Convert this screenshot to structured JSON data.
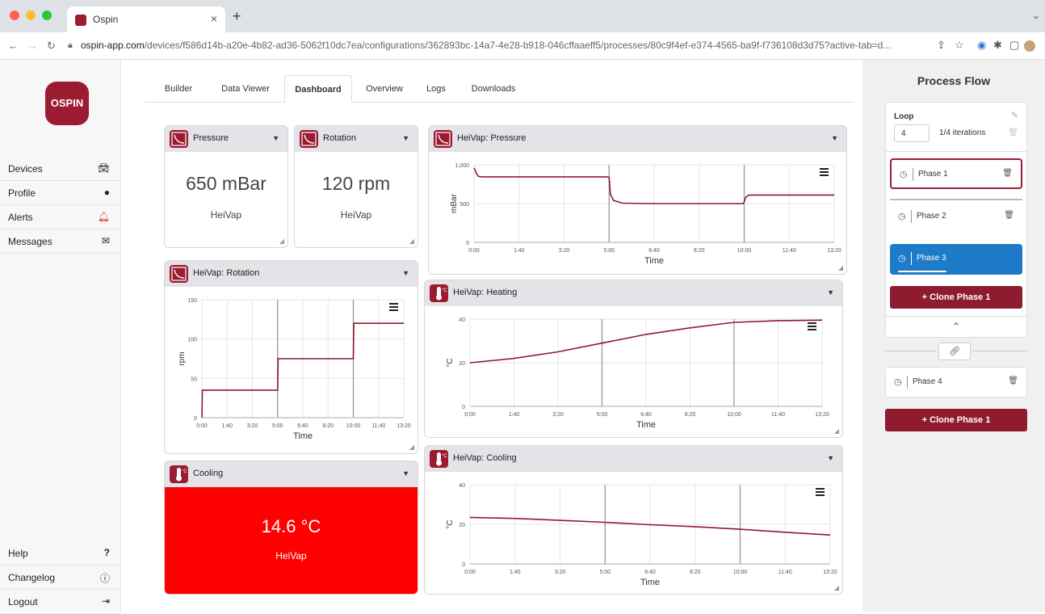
{
  "browser": {
    "tab_title": "Ospin",
    "tab_close": "×",
    "new_tab": "+",
    "url_domain": "ospin-app.com",
    "url_path": "/devices/f586d14b-a20e-4b82-ad36-5062f10dc7ea/configurations/362893bc-14a7-4e28-b918-046cffaaeff5/processes/80c9f4ef-e374-4565-ba9f-f736108d3d75?active-tab=d..."
  },
  "logo": "OSPIN",
  "sidebar": {
    "items": [
      {
        "label": "Devices",
        "icon": "car-icon"
      },
      {
        "label": "Profile",
        "icon": "user-icon"
      },
      {
        "label": "Alerts",
        "icon": "bell-icon"
      },
      {
        "label": "Messages",
        "icon": "envelope-icon"
      }
    ],
    "bottom": [
      {
        "label": "Help",
        "icon": "question-icon"
      },
      {
        "label": "Changelog",
        "icon": "info-icon"
      },
      {
        "label": "Logout",
        "icon": "logout-icon"
      }
    ]
  },
  "tabs": [
    "Builder",
    "Data Viewer",
    "Dashboard",
    "Overview",
    "Logs",
    "Downloads"
  ],
  "active_tab": "Dashboard",
  "widgets": {
    "pressure": {
      "title": "Pressure",
      "value": "650 mBar",
      "source": "HeiVap"
    },
    "rotation": {
      "title": "Rotation",
      "value": "120 rpm",
      "source": "HeiVap"
    },
    "cooling": {
      "title": "Cooling",
      "value": "14.6 °C",
      "source": "HeiVap",
      "color": "#ff0000"
    },
    "hv_pressure": {
      "title": "HeiVap: Pressure"
    },
    "hv_rotation": {
      "title": "HeiVap: Rotation"
    },
    "hv_heating": {
      "title": "HeiVap: Heating"
    },
    "hv_cooling": {
      "title": "HeiVap: Cooling"
    }
  },
  "chart_data": [
    {
      "type": "line",
      "id": "hv_pressure",
      "title": "HeiVap: Pressure",
      "xlabel": "Time",
      "ylabel": "mBar",
      "ylim": [
        0,
        1000
      ],
      "yticks": [
        0,
        500,
        1000
      ],
      "ytick_labels": [
        "0",
        "500",
        "1,000"
      ],
      "xticks": [
        "0:00",
        "1:40",
        "3:20",
        "5:00",
        "6:40",
        "8:20",
        "10:00",
        "11:40",
        "13:20"
      ],
      "xlim_seconds": [
        0,
        800
      ],
      "markers_seconds": [
        300,
        600
      ],
      "series": [
        {
          "x": [
            0,
            5,
            10,
            20,
            100,
            200,
            295,
            300,
            303,
            310,
            330,
            400,
            500,
            598,
            600,
            603,
            610,
            700,
            800
          ],
          "y": [
            960,
            890,
            850,
            845,
            845,
            845,
            845,
            840,
            620,
            540,
            505,
            500,
            500,
            500,
            520,
            580,
            610,
            610,
            610
          ]
        }
      ]
    },
    {
      "type": "line",
      "id": "hv_rotation",
      "title": "HeiVap: Rotation",
      "xlabel": "Time",
      "ylabel": "rpm",
      "ylim": [
        0,
        150
      ],
      "yticks": [
        0,
        50,
        100,
        150
      ],
      "ytick_labels": [
        "0",
        "50",
        "100",
        "150"
      ],
      "xticks": [
        "0:00",
        "1:40",
        "3:20",
        "5:00",
        "6:40",
        "8:20",
        "10:00",
        "11:40",
        "13:20"
      ],
      "xlim_seconds": [
        0,
        800
      ],
      "markers_seconds": [
        300,
        600
      ],
      "series": [
        {
          "x": [
            0,
            2,
            300,
            302,
            600,
            602,
            800
          ],
          "y": [
            0,
            35,
            35,
            75,
            75,
            120,
            120
          ]
        }
      ]
    },
    {
      "type": "line",
      "id": "hv_heating",
      "title": "HeiVap: Heating",
      "xlabel": "Time",
      "ylabel": "°C",
      "ylim": [
        0,
        40
      ],
      "yticks": [
        0,
        20,
        40
      ],
      "ytick_labels": [
        "0",
        "20",
        "40"
      ],
      "xticks": [
        "0:00",
        "1:40",
        "3:20",
        "5:00",
        "6:40",
        "8:20",
        "10:00",
        "11:40",
        "13:20"
      ],
      "xlim_seconds": [
        0,
        800
      ],
      "markers_seconds": [
        300,
        600
      ],
      "series": [
        {
          "x": [
            0,
            100,
            200,
            300,
            400,
            500,
            600,
            700,
            800
          ],
          "y": [
            20,
            22,
            25,
            29,
            33,
            36,
            38.5,
            39.3,
            39.5
          ]
        }
      ]
    },
    {
      "type": "line",
      "id": "hv_cooling",
      "title": "HeiVap: Cooling",
      "xlabel": "Time",
      "ylabel": "°C",
      "ylim": [
        0,
        40
      ],
      "yticks": [
        0,
        20,
        40
      ],
      "ytick_labels": [
        "0",
        "20",
        "40"
      ],
      "xticks": [
        "0:00",
        "1:40",
        "3:20",
        "5:00",
        "6:40",
        "8:20",
        "10:00",
        "11:40",
        "13:20"
      ],
      "xlim_seconds": [
        0,
        800
      ],
      "markers_seconds": [
        300,
        600
      ],
      "series": [
        {
          "x": [
            0,
            100,
            200,
            300,
            400,
            500,
            600,
            700,
            800
          ],
          "y": [
            23.5,
            23,
            22,
            21,
            19.8,
            18.8,
            17.5,
            16,
            14.6
          ]
        }
      ]
    }
  ],
  "process_flow": {
    "title": "Process Flow",
    "loop_label": "Loop",
    "loop_count": "4",
    "iterations": "1/4 iterations",
    "phases": [
      "Phase 1",
      "Phase 2",
      "Phase 3",
      "Phase 4"
    ],
    "active_phase": "Phase 3",
    "clone_label": "Clone Phase 1",
    "clone_prefix": "+",
    "accent": "#1e7bc8",
    "brand": "#8e1b2e"
  }
}
